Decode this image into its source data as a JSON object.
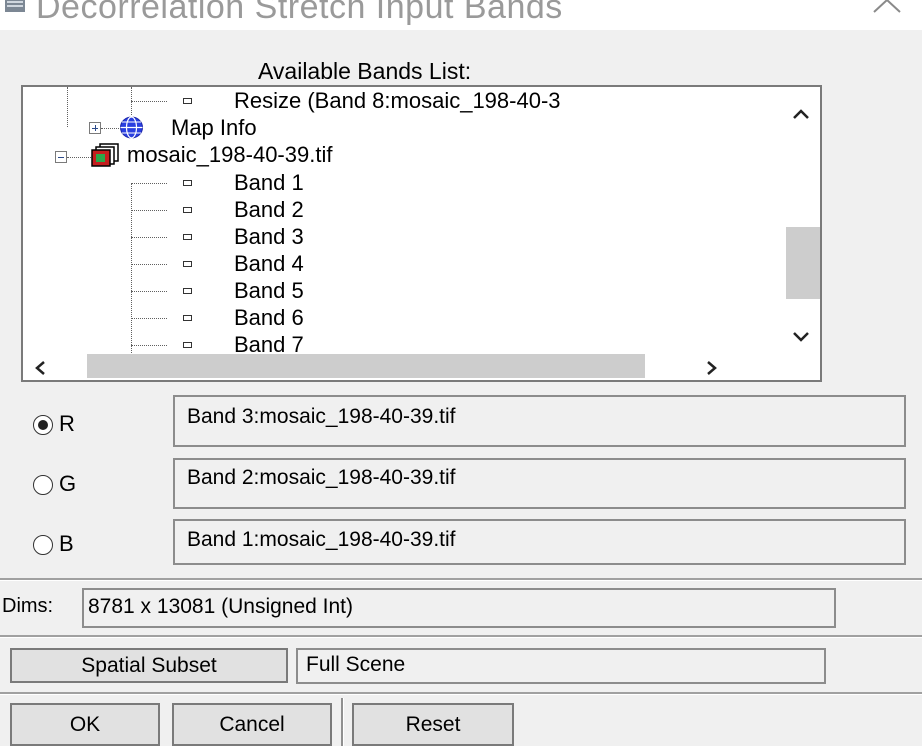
{
  "window": {
    "title": "Decorrelation Stretch Input Bands"
  },
  "available_bands": {
    "label": "Available Bands List:",
    "items": [
      "Resize (Band 8:mosaic_198-40-3",
      "Map Info",
      "mosaic_198-40-39.tif",
      "Band 1",
      "Band 2",
      "Band 3",
      "Band 4",
      "Band 5",
      "Band 6",
      "Band 7"
    ]
  },
  "rgb": {
    "selected": "R",
    "rows": [
      {
        "label": "R",
        "value": "Band 3:mosaic_198-40-39.tif"
      },
      {
        "label": "G",
        "value": "Band 2:mosaic_198-40-39.tif"
      },
      {
        "label": "B",
        "value": "Band 1:mosaic_198-40-39.tif"
      }
    ]
  },
  "dims": {
    "label": "Dims:",
    "value": "8781 x 13081 (Unsigned Int)"
  },
  "subset": {
    "button": "Spatial Subset",
    "value": "Full Scene"
  },
  "buttons": {
    "ok": "OK",
    "cancel": "Cancel",
    "reset": "Reset"
  },
  "icons": {
    "title": "window-icon",
    "map_info": "globe-icon",
    "file": "raster-file-icon"
  }
}
